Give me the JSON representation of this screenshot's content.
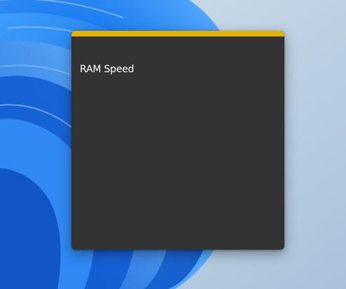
{
  "note": {
    "text": "RAM Speed",
    "accent_color": "#e5b300",
    "background_color": "#333333"
  },
  "desktop": {
    "wallpaper": "windows-11-bloom"
  }
}
